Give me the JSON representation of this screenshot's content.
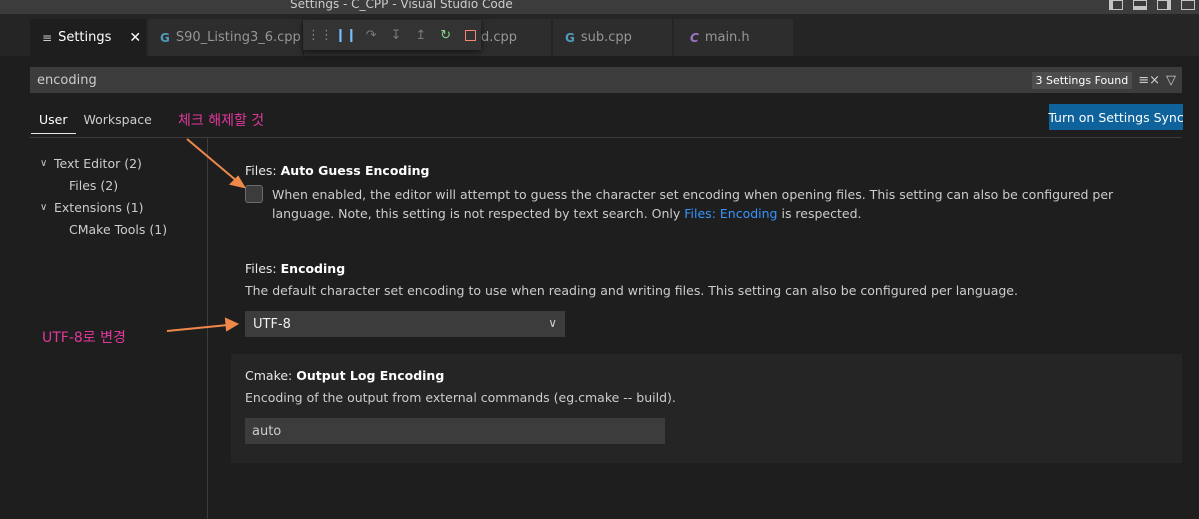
{
  "window": {
    "title": "Settings - C_CPP - Visual Studio Code"
  },
  "tabs": [
    {
      "label": "Settings",
      "icon": "menu-icon",
      "active": true
    },
    {
      "label": "S90_Listing3_6.cpp",
      "icon": "cpp-icon"
    },
    {
      "label": "d.cpp",
      "icon": "cpp-icon"
    },
    {
      "label": "sub.cpp",
      "icon": "cpp-icon"
    },
    {
      "label": "main.h",
      "icon": "c-header-icon"
    }
  ],
  "debug_toolbar": [
    "grip-icon",
    "pause-icon",
    "step-over-icon",
    "step-into-icon",
    "step-out-icon",
    "restart-icon",
    "stop-icon"
  ],
  "search": {
    "value": "encoding",
    "result_count": "3 Settings Found"
  },
  "scope_tabs": {
    "user": "User",
    "workspace": "Workspace"
  },
  "sync_button": "Turn on Settings Sync",
  "toc": [
    {
      "label": "Text Editor (2)",
      "expanded": true
    },
    {
      "label": "Files (2)",
      "child": true
    },
    {
      "label": "Extensions (1)",
      "expanded": true
    },
    {
      "label": "CMake Tools (1)",
      "child": true
    }
  ],
  "settings": {
    "auto_guess": {
      "category": "Files: ",
      "name": "Auto Guess Encoding",
      "desc_pre": "When enabled, the editor will attempt to guess the character set encoding when opening files. This setting can also be configured per language. Note, this setting is not respected by text search. Only ",
      "link": "Files: Encoding",
      "desc_post": " is respected.",
      "checked": false
    },
    "encoding": {
      "category": "Files: ",
      "name": "Encoding",
      "desc": "The default character set encoding to use when reading and writing files. This setting can also be configured per language.",
      "value": "UTF-8"
    },
    "cmake_output": {
      "category": "Cmake: ",
      "name": "Output Log Encoding",
      "desc": "Encoding of the output from external commands (eg.cmake -- build).",
      "value": "auto"
    }
  },
  "annotations": {
    "uncheck_note": "체크 해제할 것",
    "utf8_note": "UTF-8로 변경",
    "color": "#e0389b",
    "arrow_color": "#f0884a"
  }
}
